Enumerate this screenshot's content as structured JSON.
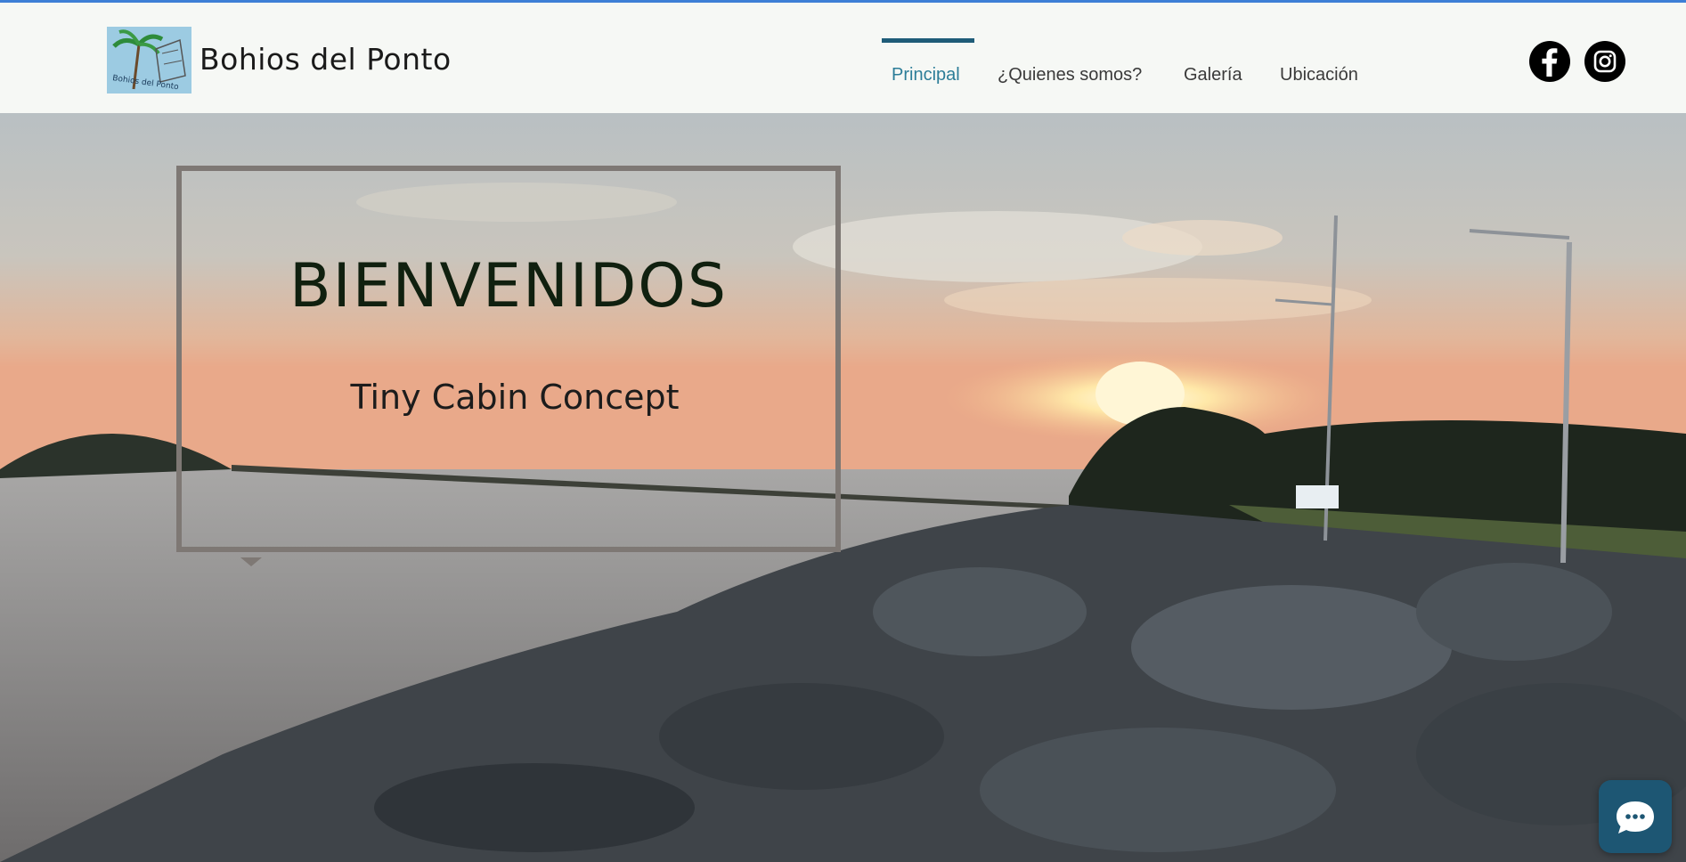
{
  "header": {
    "site_title": "Bohios del Ponto",
    "logo_text": "Bohios del Ponto"
  },
  "nav": {
    "items": [
      {
        "label": "Principal",
        "active": true
      },
      {
        "label": "¿Quienes somos?",
        "active": false
      },
      {
        "label": "Galería",
        "active": false
      },
      {
        "label": "Ubicación",
        "active": false
      }
    ]
  },
  "social": {
    "facebook_icon": "facebook-icon",
    "instagram_icon": "instagram-icon"
  },
  "hero": {
    "title": "BIENVENIDOS",
    "subtitle": "Tiny Cabin Concept"
  },
  "chat": {
    "icon": "chat-bubble-icon"
  },
  "colors": {
    "accent": "#2c7d98",
    "nav_bar": "#1f5c78",
    "chat_button": "#1d5673",
    "box_border": "#7e7874"
  }
}
